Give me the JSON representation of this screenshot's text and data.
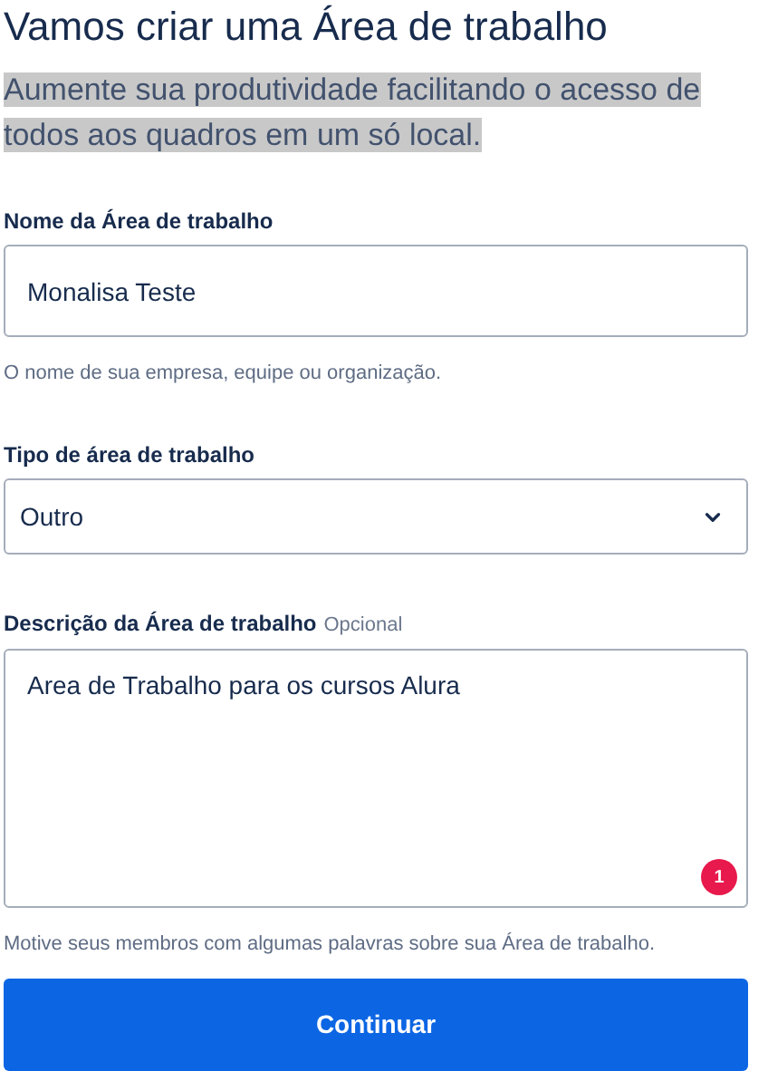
{
  "title": "Vamos criar uma Área de trabalho",
  "subtitle": "Aumente sua produtividade facilitando o acesso de todos aos quadros em um só local.",
  "fields": [
    {
      "kind": "text",
      "label": "Nome da Área de trabalho",
      "value": "Monalisa Teste",
      "help": "O nome de sua empresa, equipe ou organização."
    },
    {
      "kind": "select",
      "label": "Tipo de área de trabalho",
      "value": "Outro"
    },
    {
      "kind": "textarea",
      "label": "Descrição da Área de trabalho",
      "optional": "Opcional",
      "value": "Area de Trabalho para os cursos Alura",
      "badge": "1",
      "help": "Motive seus membros com algumas palavras sobre sua Área de trabalho."
    }
  ],
  "button": "Continuar"
}
